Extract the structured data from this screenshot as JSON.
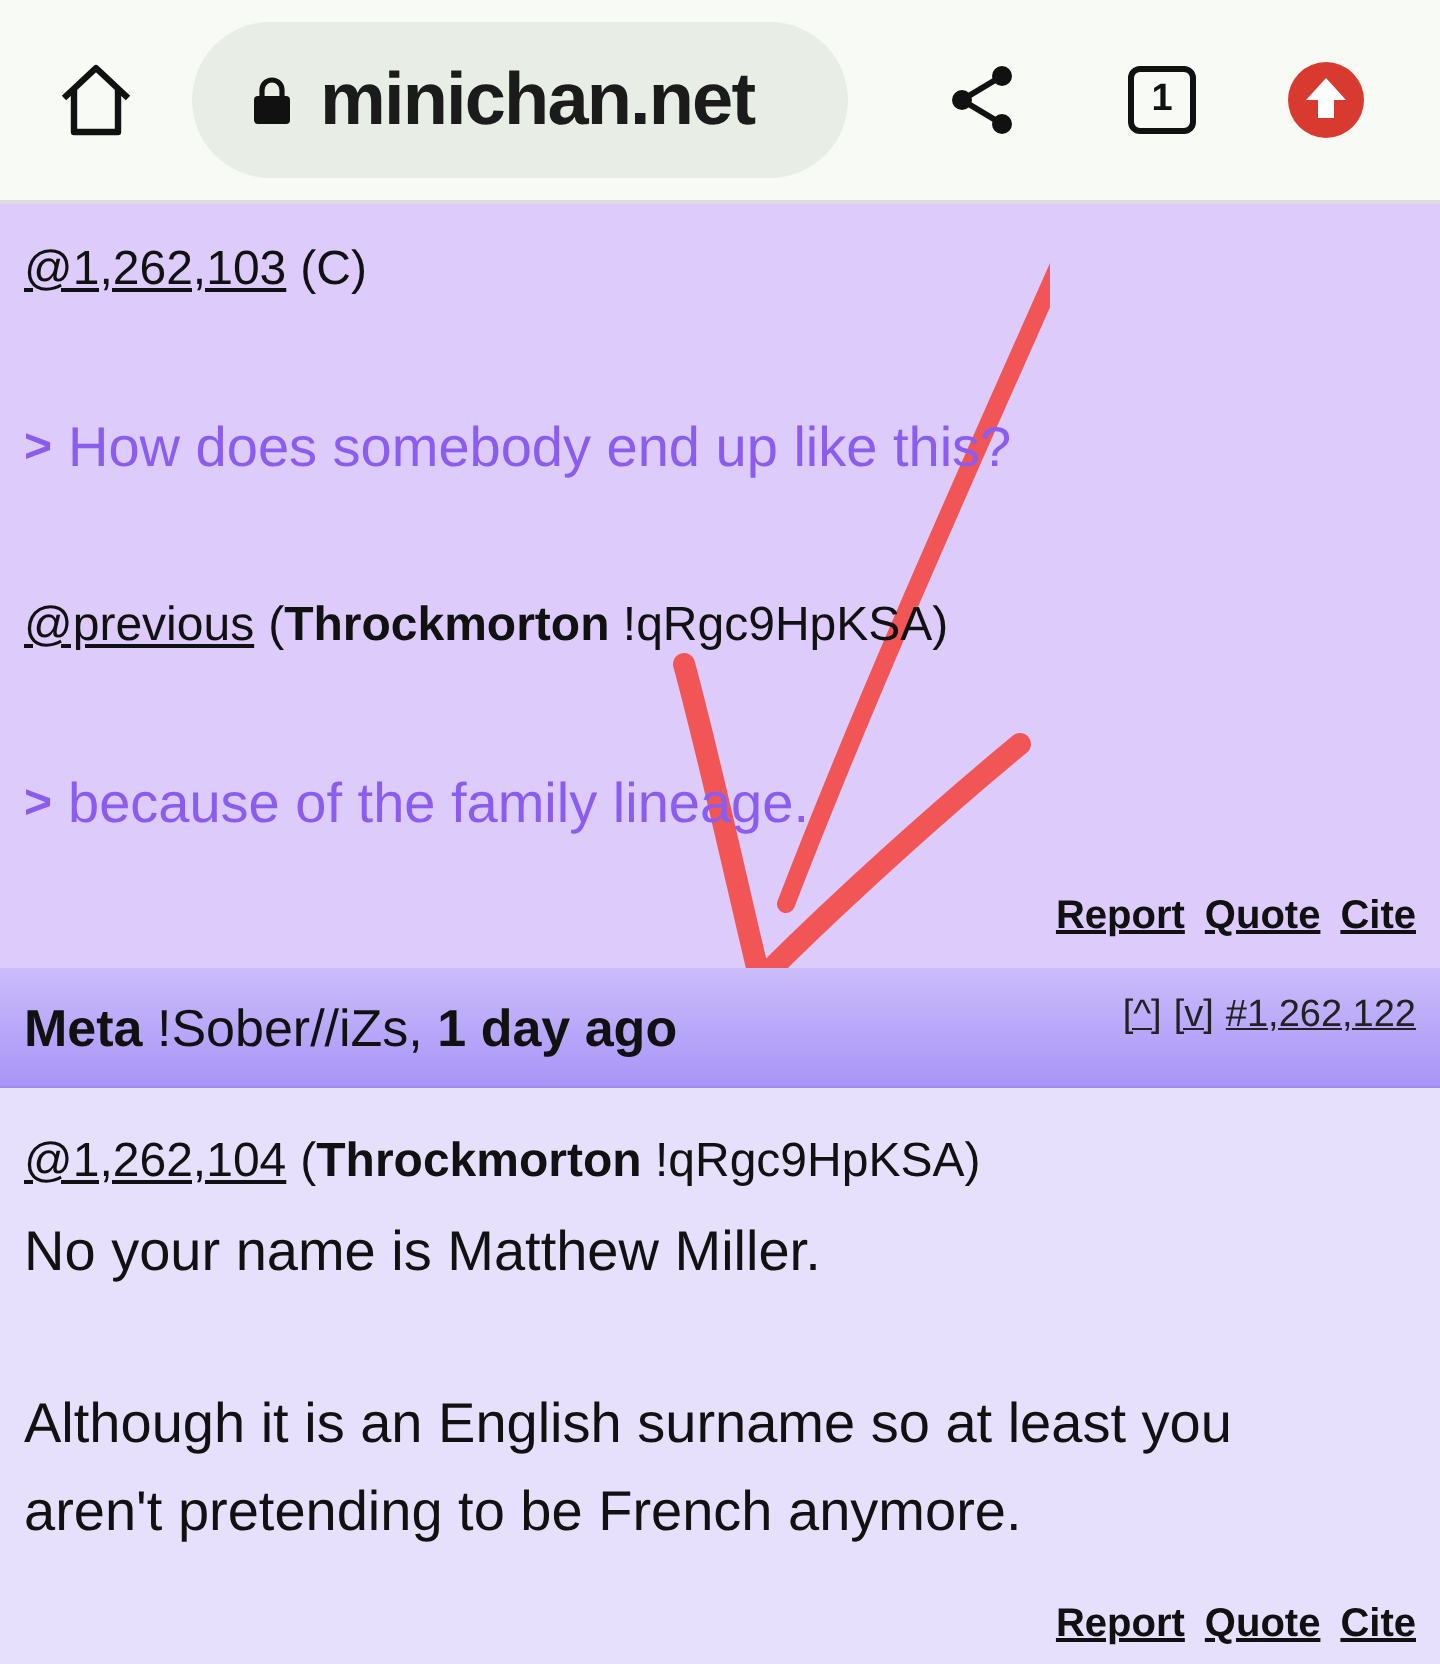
{
  "browser": {
    "url": "minichan.net",
    "tab_count": "1"
  },
  "posts": [
    {
      "blocks": [
        {
          "kind": "cite",
          "ref": "@1,262,103",
          "detail": "(C)"
        },
        {
          "kind": "quote",
          "marker": ">",
          "text": "How does somebody end up like this?"
        },
        {
          "kind": "cite",
          "ref": "@previous",
          "detail": "(**Throckmorton** !qRgc9HpKSA)"
        },
        {
          "kind": "quote",
          "marker": ">",
          "text": "because of the family lineage."
        }
      ],
      "actions": [
        "Report",
        "Quote",
        "Cite"
      ]
    },
    {
      "header": {
        "title": "**Meta** !Sober//iZs, **1 day ago**",
        "links": [
          "[^]",
          "[v]",
          "#1,262,122"
        ]
      },
      "blocks": [
        {
          "kind": "cite",
          "ref": "@1,262,104",
          "detail": "(**Throckmorton** !qRgc9HpKSA)"
        },
        {
          "kind": "text",
          "paragraphs": [
            "No your name is Matthew Miller.",
            "Although it is an English surname so at least you aren't pretending to be French anymore."
          ]
        }
      ],
      "actions": [
        "Report",
        "Quote",
        "Cite"
      ]
    }
  ]
}
